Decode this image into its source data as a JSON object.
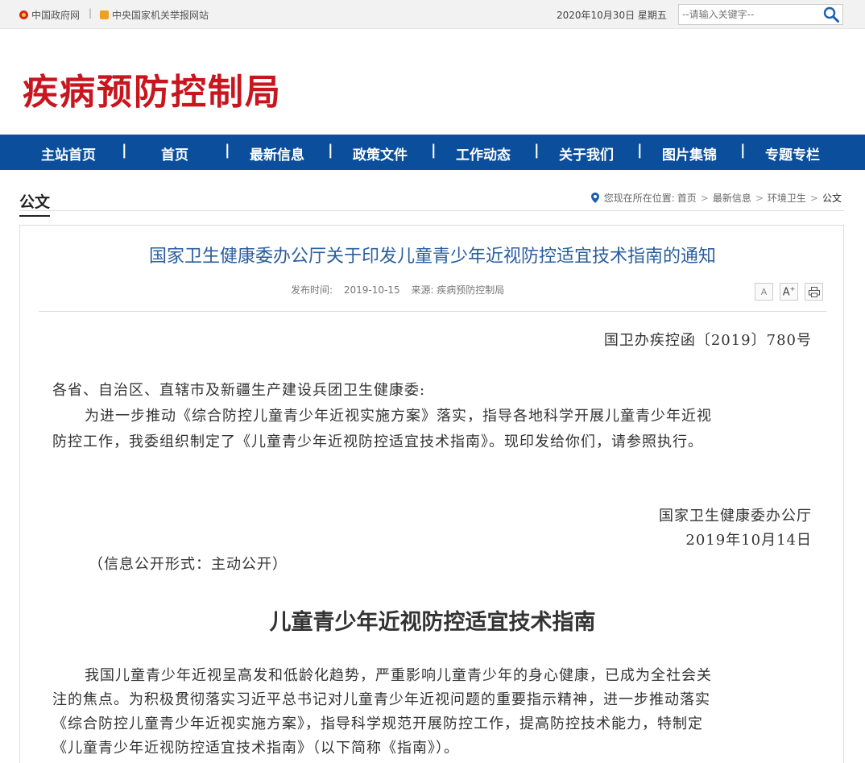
{
  "topbar": {
    "link_gov": "中国政府网",
    "divider": "|",
    "link_report": "中央国家机关举报网站",
    "date": "2020年10月30日 星期五",
    "search_placeholder": "--请输入关键字--"
  },
  "site": {
    "logo": "疾病预防控制局"
  },
  "nav": [
    "主站首页",
    "首页",
    "最新信息",
    "政策文件",
    "工作动态",
    "关于我们",
    "图片集锦",
    "专题专栏"
  ],
  "nav_sep": "|",
  "section": {
    "title": "公文"
  },
  "breadcrumb": {
    "prefix": "您现在所在位置:",
    "items": [
      "首页",
      "最新信息",
      "环境卫生",
      "公文"
    ],
    "arrow": ">"
  },
  "article": {
    "title": "国家卫生健康委办公厅关于印发儿童青少年近视防控适宜技术指南的通知",
    "publish_label": "发布时间:",
    "publish_date": "2019-10-15",
    "source": "来源: 疾病预防控制局",
    "tools": {
      "font_small": "A",
      "font_large": "A",
      "font_large_sup": "+"
    },
    "doc_number": "国卫办疾控函〔2019〕780号",
    "addressee": "各省、自治区、直辖市及新疆生产建设兵团卫生健康委:",
    "body_line1": "为进一步推动《综合防控儿童青少年近视实施方案》落实，指导各地科学开展儿童青少年近视",
    "body_line2": "防控工作，我委组织制定了《儿童青少年近视防控适宜技术指南》。现印发给你们，请参照执行。",
    "signer": "国家卫生健康委办公厅",
    "sign_date": "2019年10月14日",
    "disclosure": "（信息公开形式：主动公开）",
    "guide_title": "儿童青少年近视防控适宜技术指南",
    "guide_line1": "我国儿童青少年近视呈高发和低龄化趋势，严重影响儿童青少年的身心健康，已成为全社会关",
    "guide_line2": "注的焦点。为积极贯彻落实习近平总书记对儿童青少年近视问题的重要指示精神，进一步推动落实",
    "guide_line3": "《综合防控儿童青少年近视实施方案》，指导科学规范开展防控工作，提高防控技术能力，特制定",
    "guide_line4": "《儿童青少年近视防控适宜技术指南》（以下简称《指南》）。"
  },
  "colors": {
    "nav_bg": "#0b4e9c",
    "logo": "#c8161e",
    "title": "#2a5e9e"
  }
}
